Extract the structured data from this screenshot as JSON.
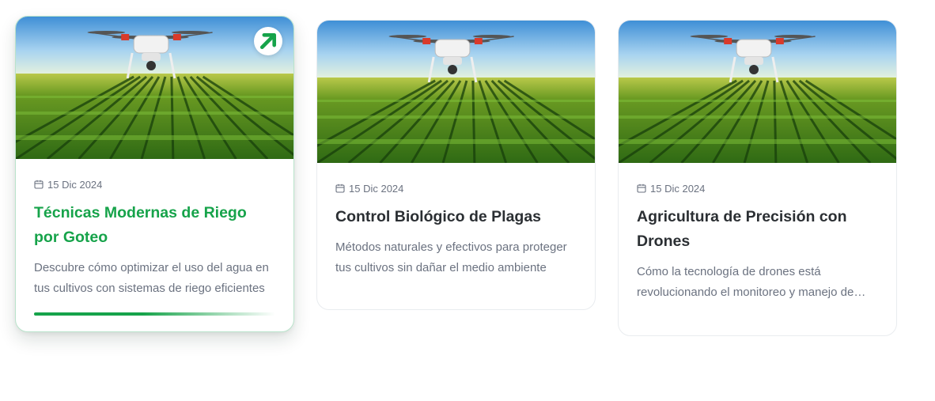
{
  "accent_color": "#16a34a",
  "cards": [
    {
      "date": "15 Dic 2024",
      "title": "Técnicas Modernas de Riego por Goteo",
      "excerpt": "Descubre cómo optimizar el uso del agua en tus cultivos con sistemas de riego eficientes",
      "state": "hovered",
      "image_subject": "drone-over-crop-field",
      "action_icon": "arrow-up-right-icon",
      "reading_progress": 0.75
    },
    {
      "date": "15 Dic 2024",
      "title": "Control Biológico de Plagas",
      "excerpt": "Métodos naturales y efectivos para proteger tus cultivos sin dañar el medio ambiente",
      "state": "default",
      "image_subject": "drone-over-crop-field"
    },
    {
      "date": "15 Dic 2024",
      "title": "Agricultura de Precisión con Drones",
      "excerpt": "Cómo la tecnología de drones está revolucionando el monitoreo y manejo de cultivos",
      "state": "default",
      "image_subject": "drone-over-crop-field"
    }
  ]
}
